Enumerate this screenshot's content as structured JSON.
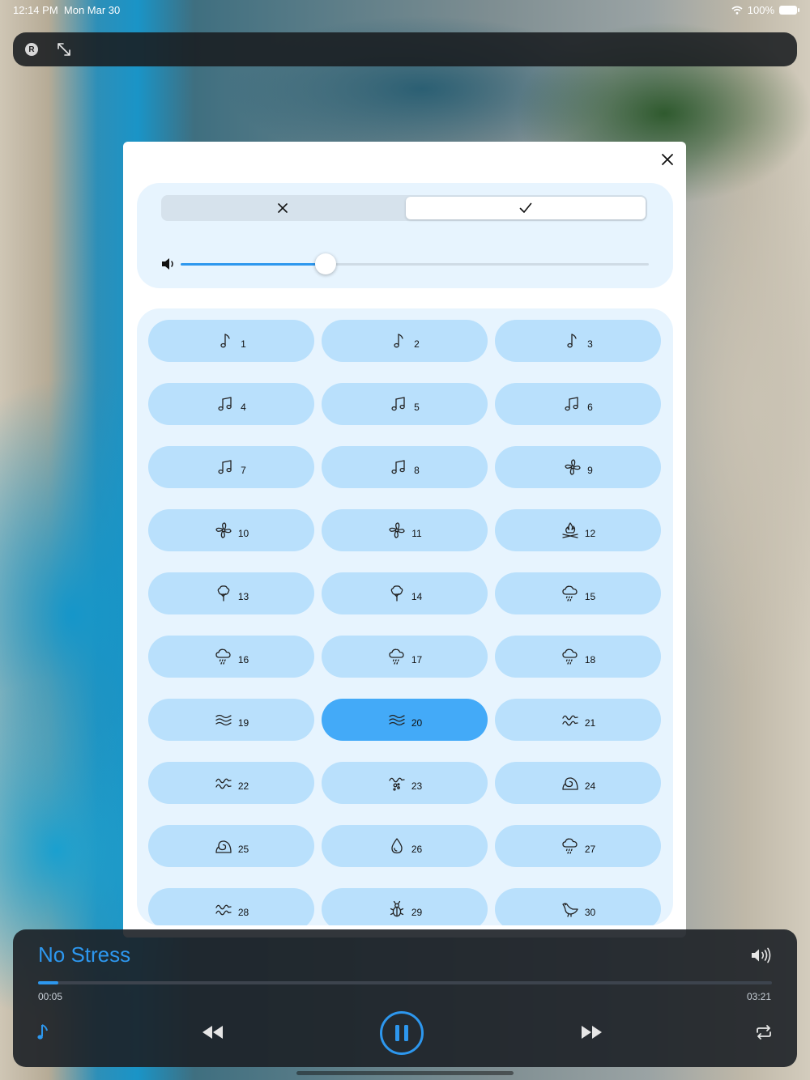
{
  "status_bar": {
    "time": "12:14 PM",
    "date": "Mon Mar 30",
    "battery": "100%",
    "wifi_icon": "wifi-icon",
    "battery_icon": "battery-icon"
  },
  "top_bar": {
    "badge_letter": "R",
    "expand_icon": "expand-arrows-icon"
  },
  "modal": {
    "close_icon": "close-icon",
    "segment": {
      "options": [
        "cancel",
        "confirm"
      ],
      "icons": [
        "x-mark-icon",
        "checkmark-icon"
      ],
      "selected_index": 1
    },
    "volume": {
      "icon": "speaker-icon",
      "level": 0.31
    },
    "sounds": [
      {
        "label": "1",
        "icon": "note"
      },
      {
        "label": "2",
        "icon": "note"
      },
      {
        "label": "3",
        "icon": "note"
      },
      {
        "label": "4",
        "icon": "notes"
      },
      {
        "label": "5",
        "icon": "notes"
      },
      {
        "label": "6",
        "icon": "notes"
      },
      {
        "label": "7",
        "icon": "notes"
      },
      {
        "label": "8",
        "icon": "notes"
      },
      {
        "label": "9",
        "icon": "fan"
      },
      {
        "label": "10",
        "icon": "fan"
      },
      {
        "label": "11",
        "icon": "fan"
      },
      {
        "label": "12",
        "icon": "campfire"
      },
      {
        "label": "13",
        "icon": "tree"
      },
      {
        "label": "14",
        "icon": "tree"
      },
      {
        "label": "15",
        "icon": "rain-cloud"
      },
      {
        "label": "16",
        "icon": "rain-cloud"
      },
      {
        "label": "17",
        "icon": "rain-cloud"
      },
      {
        "label": "18",
        "icon": "rain-cloud"
      },
      {
        "label": "19",
        "icon": "wind-waves"
      },
      {
        "label": "20",
        "icon": "wind-waves"
      },
      {
        "label": "21",
        "icon": "sea-waves"
      },
      {
        "label": "22",
        "icon": "sea-waves"
      },
      {
        "label": "23",
        "icon": "bubbles-waves"
      },
      {
        "label": "24",
        "icon": "snail-shell"
      },
      {
        "label": "25",
        "icon": "snail-shell"
      },
      {
        "label": "26",
        "icon": "water-drop"
      },
      {
        "label": "27",
        "icon": "rain-cloud"
      },
      {
        "label": "28",
        "icon": "sea-waves"
      },
      {
        "label": "29",
        "icon": "insect"
      },
      {
        "label": "30",
        "icon": "bird"
      }
    ],
    "selected_sound": "20"
  },
  "player": {
    "title": "No Stress",
    "current_time": "00:05",
    "total_time": "03:21",
    "progress": 0.028,
    "icons": {
      "volume": "speaker-wave-icon",
      "music": "music-note-icon",
      "rewind": "rewind-icon",
      "pause": "pause-icon",
      "fast_forward": "fast-forward-icon",
      "repeat": "repeat-icon"
    }
  },
  "colors": {
    "accent": "#2d97ee",
    "tile": "#b9e0fc",
    "tile_selected": "#43aaf8",
    "panel": "#e7f4fe",
    "player_bg": "#1c2026"
  }
}
